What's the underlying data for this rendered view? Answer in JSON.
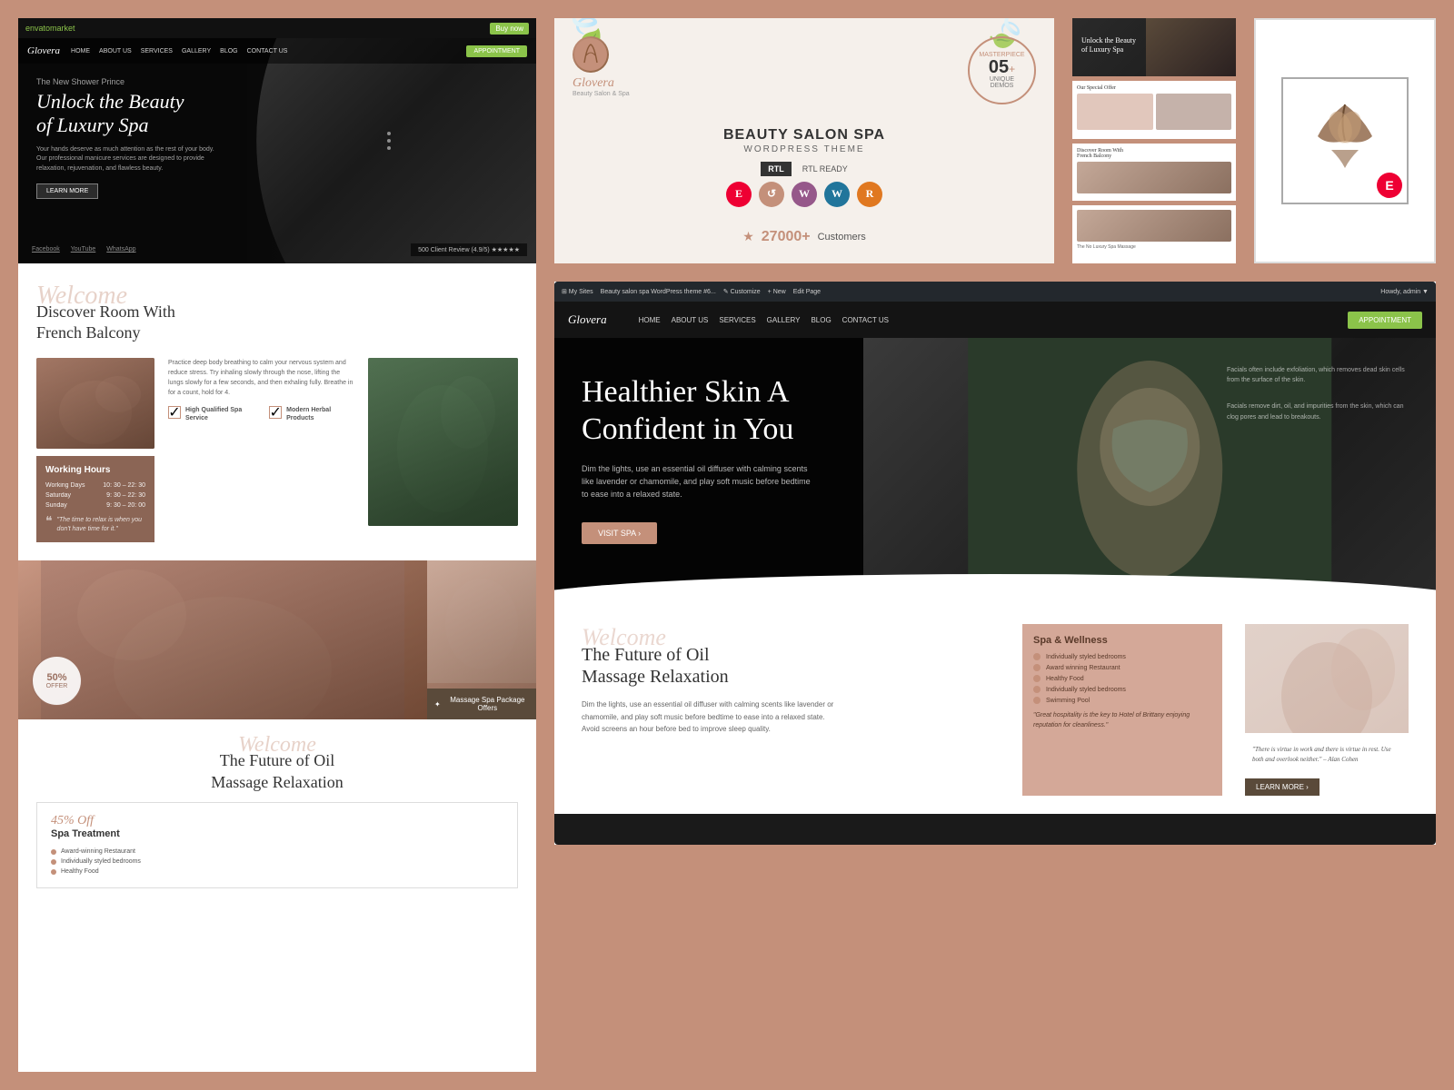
{
  "page": {
    "background": "#c4907a",
    "title": "Glovera Beauty Salon Spa WordPress Theme"
  },
  "envato": {
    "logo": "envatomarket",
    "try_now": "Buy now"
  },
  "hero": {
    "subtitle": "The New Shower Prince",
    "title": "Unlock the Beauty of Luxury Spa",
    "description": "Your hands deserve as much attention as the rest of your body. Our professional manicure services are designed to provide relaxation, rejuvenation, and flawless beauty.",
    "learn_more": "LEARN MORE",
    "review": "500 Client Review (4.9/5) ★★★★★",
    "social": [
      "Facebook",
      "YouTube",
      "WhatsApp"
    ],
    "nav_items": [
      "HOME",
      "ABOUT US",
      "SERVICES",
      "GALLERY",
      "BLOG",
      "CONTACT US"
    ],
    "appointment": "APPOINTMENT"
  },
  "discover": {
    "welcome": "Welcome",
    "title": "Discover Room With\nFrench Balcony",
    "description": "Practice deep body breathing to calm your nervous system and reduce stress. Try inhaling slowly through the nose, lifting the lungs slowly for a few seconds, and then exhaling fully. Breathe in for a count, hold for 4.",
    "features": [
      {
        "icon": "✓",
        "text": "High Qualified\nSpa Service"
      },
      {
        "icon": "✓",
        "text": "Modern Herbal\nProducts"
      }
    ]
  },
  "working_hours": {
    "title": "Working Hours",
    "days": [
      {
        "day": "Working Days",
        "hours": "10: 30 – 22: 30"
      },
      {
        "day": "Saturday",
        "hours": "9: 30 – 22: 30"
      },
      {
        "day": "Sunday",
        "hours": "9: 30 – 20: 00"
      }
    ],
    "quote": "\"The time to relax is when you don't have time for it.\""
  },
  "marketing": {
    "brand_name": "Glovera",
    "brand_tagline": "Beauty  Salon & Spa",
    "demos_count": "05+",
    "demos_label": "UNIQUE\nDEMOS",
    "watermark": "MASTERPIECE",
    "beauty_salon": "BEAUTY SALON SPA",
    "wordpress_theme": "WORDPRESS THEME",
    "rtl_ready": "RTL READY",
    "plugins": [
      "E",
      "W",
      "WP",
      "R"
    ],
    "customers_count": "27000+",
    "customers_label": "Customers"
  },
  "admin_hero": {
    "title": "Healthier Skin A\nConfident in You",
    "description": "Dim the lights, use an essential oil diffuser with calming scents like lavender or chamomile, and play soft music before bedtime to ease into a relaxed state.",
    "side_text": "Facials often include exfoliation, which removes dead skin cells from the surface of the skin.",
    "side_text2": "Facials remove dirt, oil, and impurities from the skin, which can clog pores and lead to breakouts.",
    "visit_btn": "VISIT SPA ›",
    "nav": [
      "HOME",
      "ABOUT US",
      "SERVICES",
      "GALLERY",
      "BLOG",
      "CONTACT US"
    ],
    "appointment": "APPOINTMENT"
  },
  "future": {
    "welcome": "Welcome",
    "title": "The Future of Oil\nMassage Relaxation",
    "description": "Dim the lights, use an essential oil diffuser with calming scents like lavender or chamomile, and play soft music before bedtime to ease into a relaxed state. Avoid screens an hour before bed to improve sleep quality.",
    "spa_wellness": {
      "title": "Spa & Wellness",
      "items": [
        "Individually styled bedrooms",
        "Award winning Restaurant",
        "Healthy Food",
        "Individually styled bedrooms",
        "Swimming Pool"
      ]
    },
    "hospitality_text": "\"Great hospitality is the key to Hotel of Brittany enjoying reputation for cleanliness.\"",
    "quote": "\"There is virtue in work and there is virtue in rest. Use both and overlook neither.\" – Alan Cohen",
    "learn_more": "LEARN MORE ›"
  },
  "sale": {
    "off": "45% Off",
    "title": "Spa Treatment",
    "items": [
      "Award-winning Restaurant",
      "Individually styled bedrooms",
      "Healthy Food"
    ]
  },
  "offer": {
    "percent": "50%",
    "label": "OFFER"
  },
  "massage_pkg": {
    "label": "Massage Spa\nPackage Offers"
  },
  "logo_card": {
    "brand": "🦋"
  }
}
